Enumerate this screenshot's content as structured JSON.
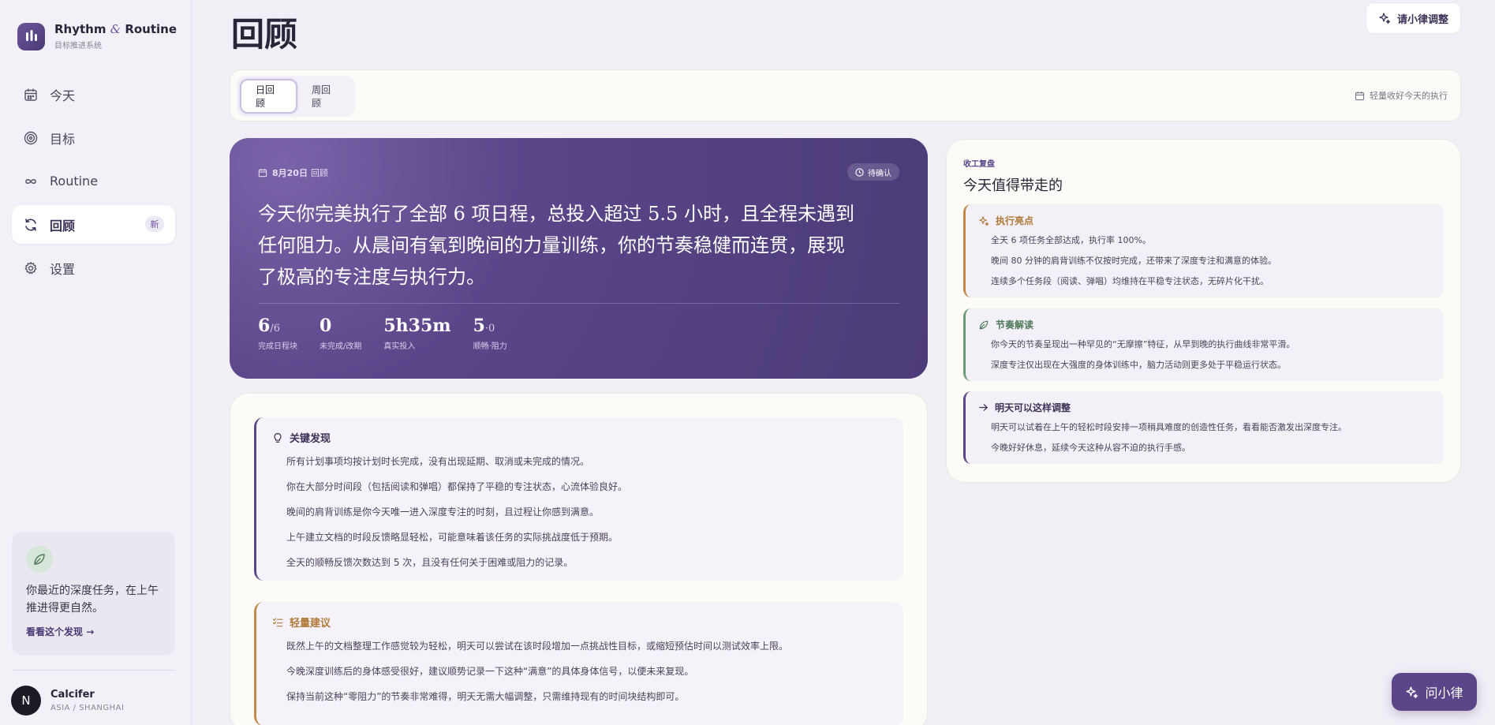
{
  "brand": {
    "name_a": "Rhythm",
    "amp": "&",
    "name_b": "Routine",
    "subtitle": "目标推进系统"
  },
  "nav": {
    "items": [
      {
        "label": "今天",
        "icon": "calendar-icon"
      },
      {
        "label": "目标",
        "icon": "target-icon"
      },
      {
        "label": "Routine",
        "icon": "infinity-icon"
      },
      {
        "label": "回顾",
        "icon": "refresh-icon",
        "badge": "新"
      },
      {
        "label": "设置",
        "icon": "gear-icon"
      }
    ]
  },
  "insight": {
    "text": "你最近的深度任务，在上午推进得更自然。",
    "link": "看看这个发现"
  },
  "user": {
    "initial": "N",
    "name": "Calcifer",
    "location": "ASIA / SHANGHAI"
  },
  "page": {
    "title": "回顾",
    "ask_button": "请小律调整"
  },
  "tabs": {
    "items": [
      "日回顾",
      "周回顾"
    ],
    "active": "日回顾",
    "hint": "轻量收好今天的执行"
  },
  "hero": {
    "date_bold": "8月20日",
    "date_suffix": "回顾",
    "status": "待确认",
    "summary": "今天你完美执行了全部 6 项日程，总投入超过 5.5 小时，且全程未遇到任何阻力。从晨间有氧到晚间的力量训练，你的节奏稳健而连贯，展现了极高的专注度与执行力。",
    "stats": [
      {
        "value": "6",
        "suffix": "/6",
        "label": "完成日程块"
      },
      {
        "value": "0",
        "suffix": "",
        "label": "未完成/改期"
      },
      {
        "value": "5h35m",
        "suffix": "",
        "label": "真实投入"
      },
      {
        "value": "5",
        "suffix": "·0",
        "label": "顺畅·阻力"
      }
    ]
  },
  "findings": {
    "title": "关键发现",
    "lines": [
      "所有计划事项均按计划时长完成，没有出现延期、取消或未完成的情况。",
      "你在大部分时间段（包括阅读和弹唱）都保持了平稳的专注状态，心流体验良好。",
      "晚间的肩背训练是你今天唯一进入深度专注的时刻，且过程让你感到满意。",
      "上午建立文档的时段反馈略显轻松，可能意味着该任务的实际挑战度低于预期。",
      "全天的顺畅反馈次数达到 5 次，且没有任何关于困难或阻力的记录。"
    ]
  },
  "suggestions": {
    "title": "轻量建议",
    "lines": [
      "既然上午的文档整理工作感觉较为轻松，明天可以尝试在该时段增加一点挑战性目标，或缩短预估时间以测试效率上限。",
      "今晚深度训练后的身体感受很好，建议顺势记录一下这种“满意”的具体身体信号，以便未来复现。",
      "保持当前这种“零阻力”的节奏非常难得，明天无需大幅调整，只需维持现有的时间块结构即可。"
    ]
  },
  "review": {
    "kicker": "收工复盘",
    "title": "今天值得带走的",
    "highlights": {
      "title": "执行亮点",
      "lines": [
        "全天 6 项任务全部达成，执行率 100%。",
        "晚间 80 分钟的肩背训练不仅按时完成，还带来了深度专注和满意的体验。",
        "连续多个任务段（阅读、弹唱）均维持在平稳专注状态，无碎片化干扰。"
      ]
    },
    "rhythm": {
      "title": "节奏解读",
      "lines": [
        "你今天的节奏呈现出一种罕见的“无摩擦”特征，从早到晚的执行曲线非常平滑。",
        "深度专注仅出现在大强度的身体训练中，脑力活动则更多处于平稳运行状态。"
      ]
    },
    "tomorrow": {
      "title": "明天可以这样调整",
      "lines": [
        "明天可以试着在上午的轻松时段安排一项稍具难度的创造性任务，看看能否激发出深度专注。",
        "今晚好好休息，延续今天这种从容不迫的执行手感。"
      ]
    }
  },
  "fab": {
    "label": "问小律"
  },
  "colors": {
    "accent": "#5a4689",
    "accent_light": "#ece8f4",
    "warm": "#c28a4a",
    "green": "#6b9a76"
  }
}
